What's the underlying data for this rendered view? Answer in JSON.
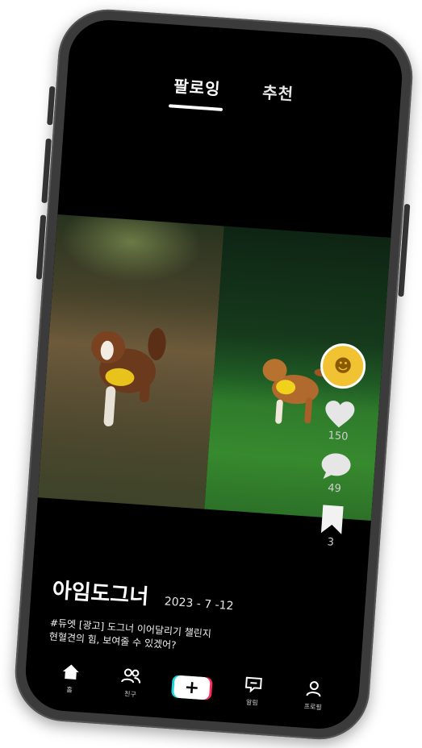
{
  "tabs": [
    {
      "label": "팔로잉",
      "active": true
    },
    {
      "label": "추천",
      "active": false
    }
  ],
  "post": {
    "username": "아임도그너",
    "date": "2023 - 7 -12",
    "description_line1": "#듀엣 [광고] 도그너 이어달리기 챌린지",
    "description_line2": "현혈견의 힘, 보여줄 수 있겠어?"
  },
  "actions": {
    "likes": "150",
    "comments": "49",
    "bookmarks": "3"
  },
  "nav": [
    {
      "label": "홈",
      "icon": "home-icon"
    },
    {
      "label": "친구",
      "icon": "friends-icon"
    },
    {
      "label": "",
      "icon": "plus-icon"
    },
    {
      "label": "알림",
      "icon": "notification-icon"
    },
    {
      "label": "프로필",
      "icon": "profile-icon"
    }
  ],
  "colors": {
    "screen_bg": "#000000",
    "phone_frame": "#3b3b3b",
    "accent_cyan": "#19d3e0",
    "accent_pink": "#ff2a5c"
  }
}
